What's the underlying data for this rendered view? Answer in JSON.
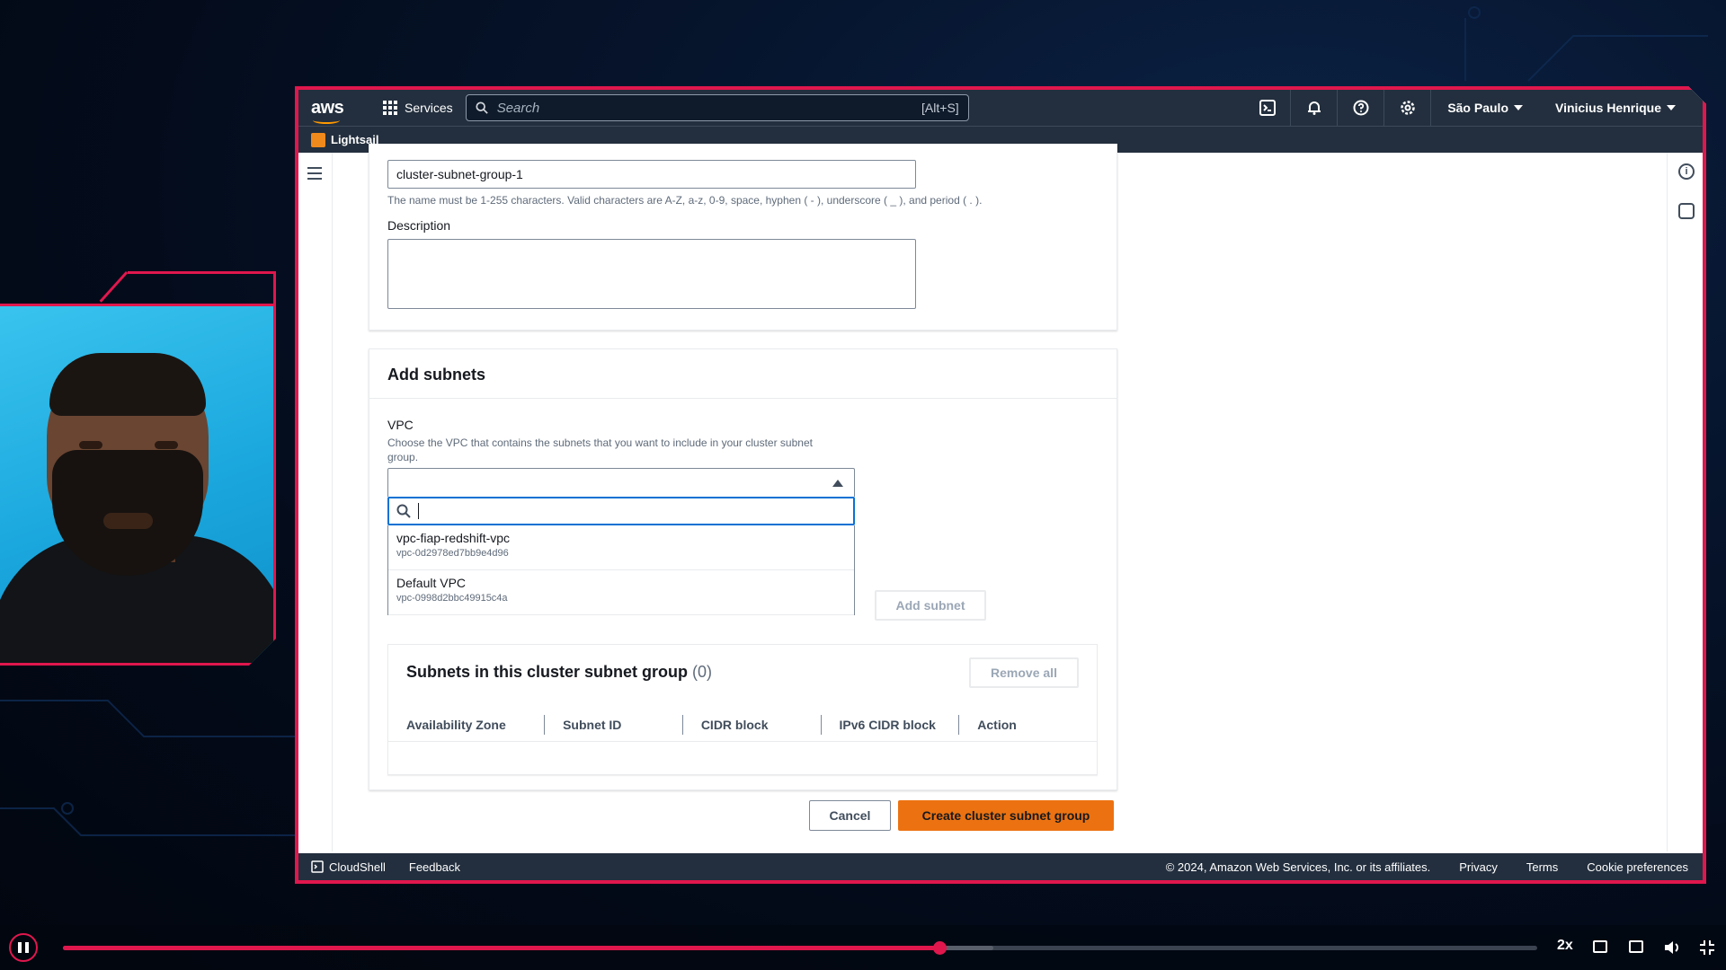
{
  "topbar": {
    "logo": "aws",
    "services_label": "Services",
    "search_placeholder": "Search",
    "search_shortcut": "[Alt+S]",
    "region": "São Paulo",
    "user": "Vinicius Henrique"
  },
  "favorites": {
    "lightsail": "Lightsail"
  },
  "form": {
    "name_value": "cluster-subnet-group-1",
    "name_hint": "The name must be 1-255 characters. Valid characters are A-Z, a-z, 0-9, space, hyphen ( - ), underscore ( _ ), and period ( . ).",
    "description_label": "Description"
  },
  "add_subnets": {
    "title": "Add subnets",
    "vpc_label": "VPC",
    "vpc_description": "Choose the VPC that contains the subnets that you want to include in your cluster subnet group.",
    "options": [
      {
        "name": "vpc-fiap-redshift-vpc",
        "id": "vpc-0d2978ed7bb9e4d96"
      },
      {
        "name": "Default VPC",
        "id": "vpc-0998d2bbc49915c4a"
      }
    ],
    "add_subnet_label": "Add subnet"
  },
  "subnets_table": {
    "title": "Subnets in this cluster subnet group",
    "count": "(0)",
    "remove_all_label": "Remove all",
    "columns": [
      "Availability Zone",
      "Subnet ID",
      "CIDR block",
      "IPv6 CIDR block",
      "Action"
    ]
  },
  "actions": {
    "cancel_label": "Cancel",
    "create_label": "Create cluster subnet group"
  },
  "footer": {
    "cloudshell": "CloudShell",
    "feedback": "Feedback",
    "copyright": "© 2024, Amazon Web Services, Inc. or its affiliates.",
    "privacy": "Privacy",
    "terms": "Terms",
    "cookie": "Cookie preferences"
  },
  "player": {
    "speed": "2x",
    "progress": 0.595
  },
  "colors": {
    "accent_frame": "#e0174d",
    "aws_nav": "#232f3e",
    "primary_button": "#ec7211",
    "focus_blue": "#0972d3"
  }
}
